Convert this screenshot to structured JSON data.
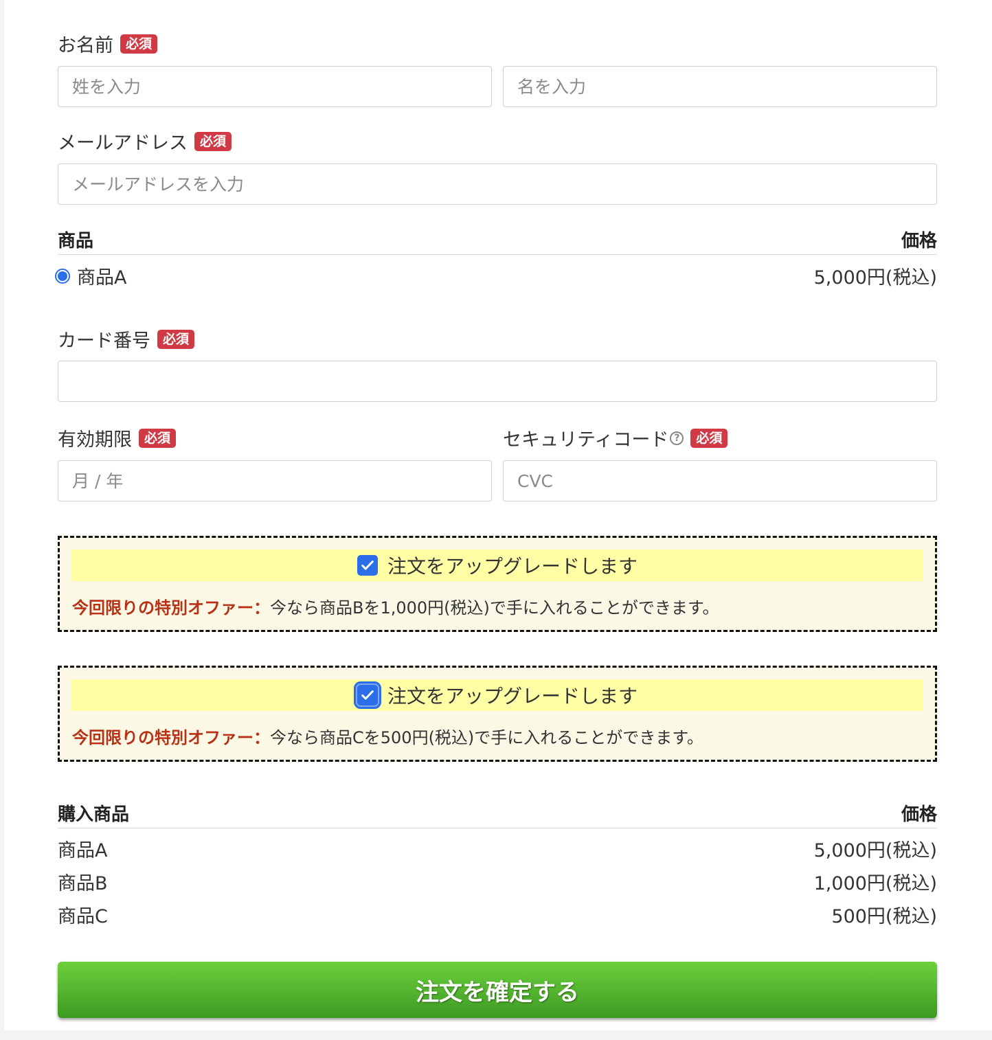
{
  "required_badge": "必須",
  "name": {
    "label": "お名前",
    "last_placeholder": "姓を入力",
    "first_placeholder": "名を入力"
  },
  "email": {
    "label": "メールアドレス",
    "placeholder": "メールアドレスを入力"
  },
  "product_table": {
    "col_product": "商品",
    "col_price": "価格",
    "rows": [
      {
        "name": "商品A",
        "price": "5,000円(税込)",
        "selected": true
      }
    ]
  },
  "card": {
    "number_label": "カード番号",
    "expiry_label": "有効期限",
    "expiry_placeholder": "月 / 年",
    "cvc_label": "セキュリティコード",
    "cvc_help_icon": "question-circle-icon",
    "cvc_placeholder": "CVC"
  },
  "upsells": [
    {
      "checkbox_label": "注文をアップグレードします",
      "checked": true,
      "offer_highlight": "今回限りの特別オファー：",
      "offer_text": "今なら商品Bを1,000円(税込)で手に入れることができます。"
    },
    {
      "checkbox_label": "注文をアップグレードします",
      "checked": true,
      "offer_highlight": "今回限りの特別オファー：",
      "offer_text": "今なら商品Cを500円(税込)で手に入れることができます。"
    }
  ],
  "summary": {
    "col_product": "購入商品",
    "col_price": "価格",
    "rows": [
      {
        "name": "商品A",
        "price": "5,000円(税込)"
      },
      {
        "name": "商品B",
        "price": "1,000円(税込)"
      },
      {
        "name": "商品C",
        "price": "500円(税込)"
      }
    ]
  },
  "submit_label": "注文を確定する",
  "colors": {
    "badge": "#d03a45",
    "accent_blue": "#2b6ee8",
    "offer_red": "#b83116",
    "upsell_bar": "#ffffa6",
    "button_green": "#4fb52c"
  }
}
